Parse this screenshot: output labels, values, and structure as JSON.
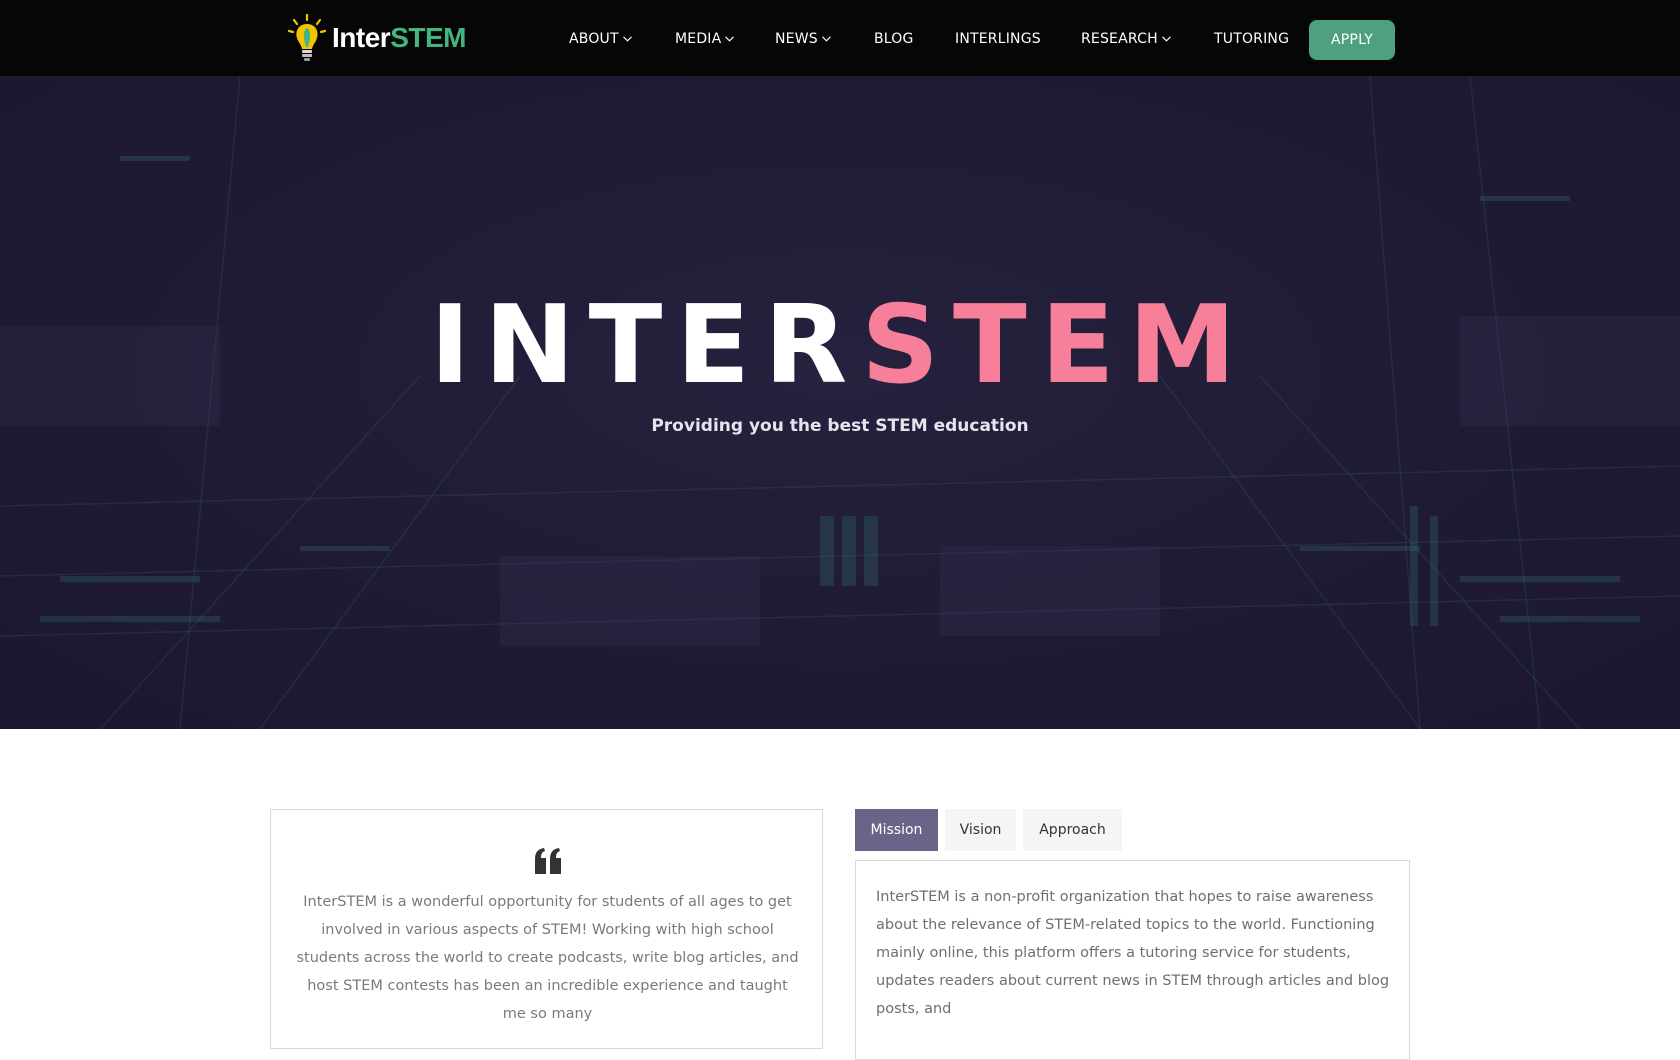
{
  "header": {
    "logo": {
      "text_inter": "Inter",
      "text_stem": "STEM",
      "icon": "lightbulb-icon"
    },
    "nav": [
      {
        "label": "ABOUT",
        "dropdown": true
      },
      {
        "label": "MEDIA",
        "dropdown": true
      },
      {
        "label": "NEWS",
        "dropdown": true
      },
      {
        "label": "BLOG",
        "dropdown": false
      },
      {
        "label": "INTERLINGS",
        "dropdown": false
      },
      {
        "label": "RESEARCH",
        "dropdown": true
      },
      {
        "label": "TUTORING",
        "dropdown": false
      }
    ],
    "apply_label": "APPLY"
  },
  "hero": {
    "title_inter": "INTER",
    "title_stem": "STEM",
    "subtitle": "Providing you the best STEM education"
  },
  "testimonial": {
    "icon": "quote-icon",
    "text": "InterSTEM is a wonderful opportunity for students of all ages to get involved in various aspects of STEM! Working with high school students across the world to create podcasts, write blog articles, and host STEM contests has been an incredible experience and taught me so many"
  },
  "tabs": {
    "items": [
      {
        "label": "Mission",
        "active": true
      },
      {
        "label": "Vision",
        "active": false
      },
      {
        "label": "Approach",
        "active": false
      }
    ],
    "panel_text": "InterSTEM is a non-profit organization that hopes to raise awareness about the relevance of STEM-related topics to the world. Functioning mainly online, this platform offers a tutoring service for students, updates readers about current news in STEM through articles and blog posts, and"
  },
  "colors": {
    "nav_bg": "#060606",
    "brand_green": "#43b581",
    "apply_bg": "#4fa07f",
    "hero_pink": "#f87f9a",
    "tab_active": "#6b6388"
  }
}
